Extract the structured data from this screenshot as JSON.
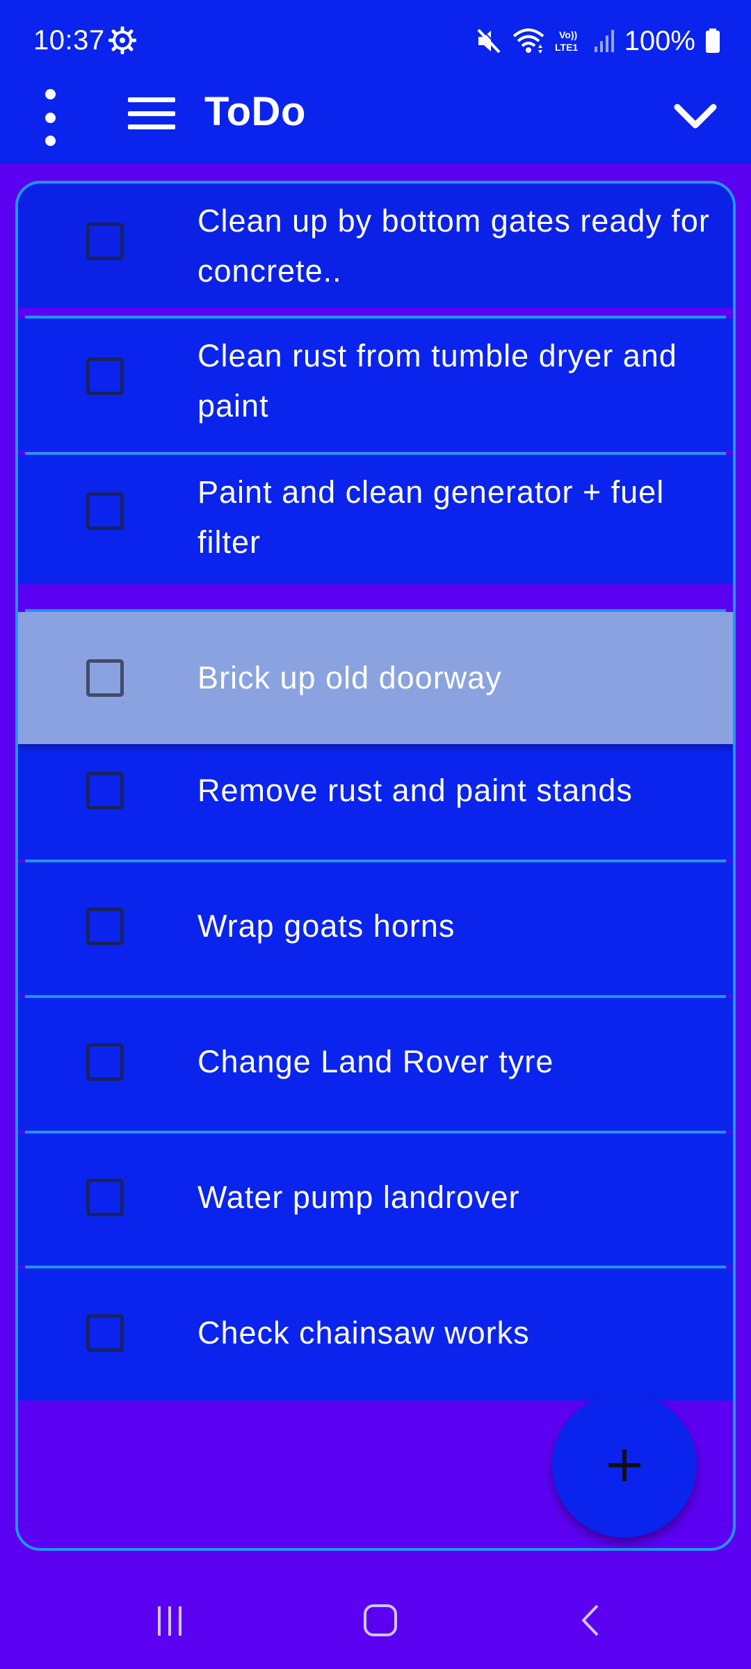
{
  "status_bar": {
    "time": "10:37",
    "battery": "100%",
    "icons": [
      "settings-gear-icon",
      "mute-icon",
      "wifi-icon",
      "volte-icon",
      "signal-icon",
      "battery-icon"
    ]
  },
  "app_bar": {
    "title": "ToDo",
    "icons": [
      "more-vert-icon",
      "menu-icon",
      "chevron-down-icon"
    ]
  },
  "todo_list": {
    "items": [
      {
        "text": "Clean up by bottom gates ready for concrete..",
        "checked": false
      },
      {
        "text": "Clean rust from tumble dryer and paint",
        "checked": false
      },
      {
        "text": "Paint and clean generator + fuel filter",
        "checked": false
      },
      {
        "text": "Brick up old doorway",
        "checked": false,
        "selected": true
      },
      {
        "text": "Remove rust and paint stands",
        "checked": false
      },
      {
        "text": "Wrap goats horns",
        "checked": false
      },
      {
        "text": "Change Land Rover tyre",
        "checked": false
      },
      {
        "text": "Water pump landrover",
        "checked": false
      },
      {
        "text": "Check chainsaw works",
        "checked": false
      }
    ]
  },
  "fab": {
    "icon": "plus-icon"
  },
  "nav_bar": {
    "icons": [
      "recents-icon",
      "home-icon",
      "back-icon"
    ]
  },
  "colors": {
    "app_bar": "#0a24ee",
    "background": "#5c00f2",
    "list_item": "#0a24ee",
    "selected_item": "#8aa3e0",
    "divider": "#2196f3"
  }
}
